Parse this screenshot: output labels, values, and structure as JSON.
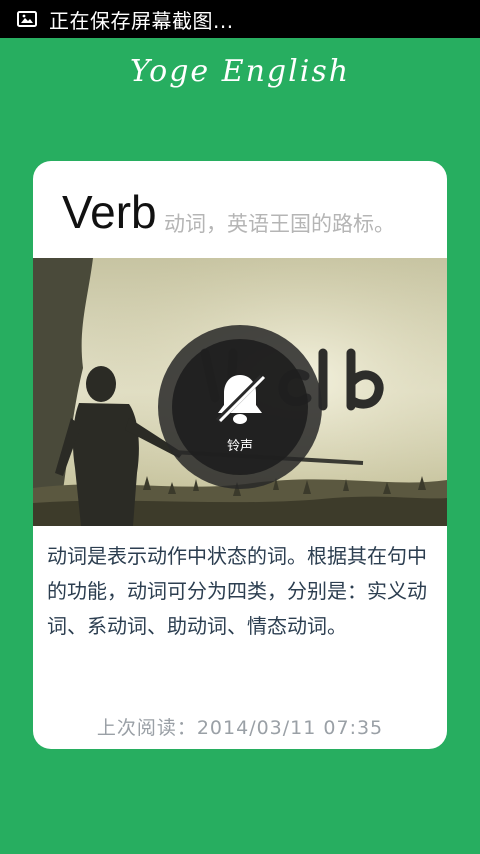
{
  "status_bar": {
    "icon": "screenshot-icon",
    "text": "正在保存屏幕截图..."
  },
  "app_title": "Yoge English",
  "card": {
    "word": "Verb",
    "subtitle": "动词，英语王国的路标。",
    "image": "armored-knight-with-verb-lettering",
    "description": "动词是表示动作中状态的词。根据其在句中的功能，动词可分为四类，分别是：实义动词、系动词、助动词、情态动词。",
    "last_read": "上次阅读：2014/03/11  07:35"
  },
  "toast": {
    "icon": "bell-muted-icon",
    "label": "铃声"
  },
  "colors": {
    "background": "#27ae60",
    "card": "#ffffff",
    "word": "#111111",
    "subtitle": "#b5b5b5",
    "description": "#2c3e50",
    "last_read": "#9aa0a6"
  }
}
